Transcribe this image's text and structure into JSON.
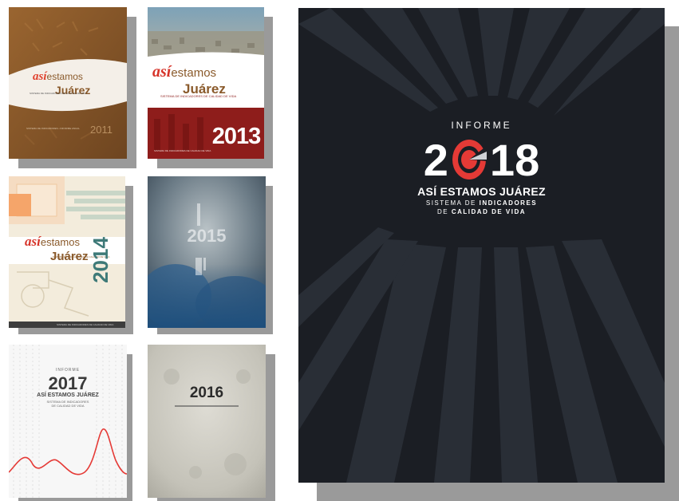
{
  "main_cover": {
    "kicker": "INFORME",
    "year_start": "2",
    "year_end": "18",
    "title": "ASÍ ESTAMOS JUÁREZ",
    "subtitle_line1_light": "SISTEMA DE",
    "subtitle_line1_bold": "INDICADORES",
    "subtitle_line2_light": "DE",
    "subtitle_line2_bold": "CALIDAD DE VIDA"
  },
  "thumbnails": {
    "t2011": {
      "brand_a": "así",
      "brand_b": "estamos",
      "brand_c": "Juárez",
      "tagline": "SISTEMA DE INDICADORES DE CALIDAD DE VIDA",
      "footer": "SISTEMA DE INDICADORES • INFORME ANUAL",
      "year": "2011"
    },
    "t2013": {
      "brand_a": "así",
      "brand_b": "estamos",
      "brand_c": "Juárez",
      "tagline": "SISTEMA DE INDICADORES DE CALIDAD DE VIDA",
      "footer": "SISTEMA DE INDICADORES DE CALIDAD DE VIDA",
      "year": "2013"
    },
    "t2014": {
      "brand_a": "así",
      "brand_b": "estamos",
      "brand_c": "Juárez",
      "tagline": "SISTEMA DE INDICADORES DE CALIDAD DE VIDA",
      "footer": "SISTEMA DE INDICADORES DE CALIDAD DE VIDA",
      "year": "2014"
    },
    "t2015": {
      "year": "2015"
    },
    "t2017": {
      "kicker": "INFORME",
      "year": "2017",
      "title": "ASÍ ESTAMOS JUÁREZ",
      "sub1": "SISTEMA DE INDICADORES",
      "sub2": "DE CALIDAD DE VIDA"
    },
    "t2016": {
      "year": "2016"
    }
  },
  "colors": {
    "dark_cover": "#1b1e24",
    "accent_red": "#e53a36",
    "brown": "#8a5a2b",
    "maroon": "#8e1d1b",
    "teal": "#3e7a78",
    "green": "#1f7a53"
  }
}
